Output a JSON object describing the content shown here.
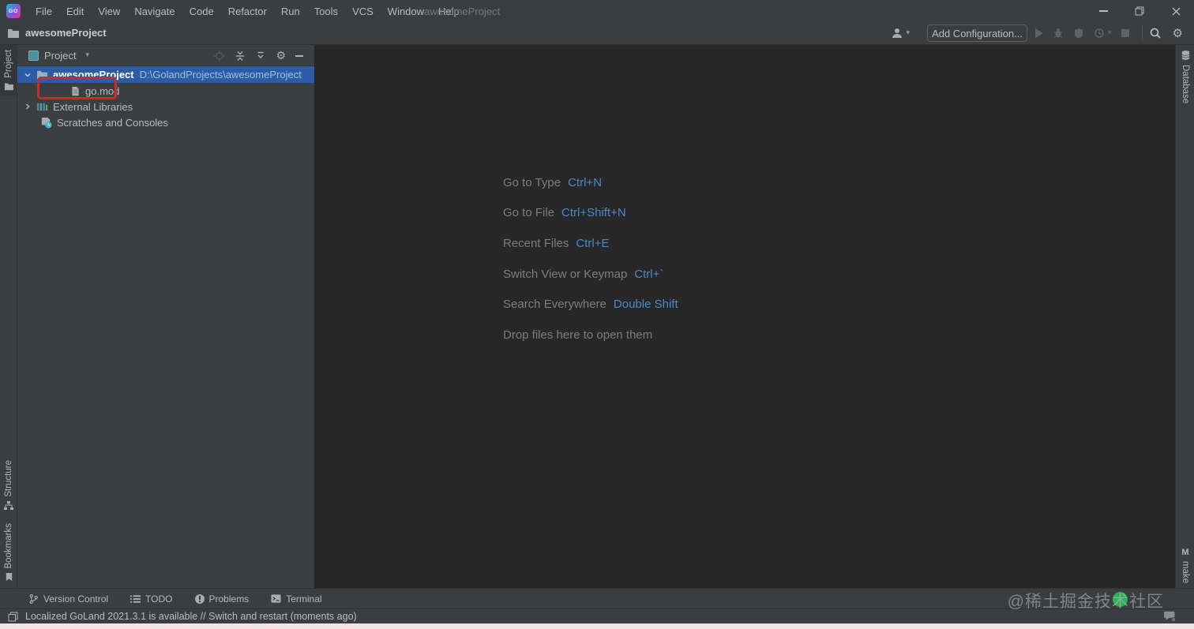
{
  "colors": {
    "panel_bg": "#3C3F41",
    "editor_bg": "#272727",
    "selection_blue": "#2D5CA6",
    "shortcut_blue": "#4D89CB",
    "annotation_red": "#CE2A26",
    "bottom_strip_pink": "#F5E4E2"
  },
  "titlebar": {
    "logo_text": "GO",
    "menu": [
      "File",
      "Edit",
      "View",
      "Navigate",
      "Code",
      "Refactor",
      "Run",
      "Tools",
      "VCS",
      "Window",
      "Help"
    ],
    "title": "awesomeProject"
  },
  "toolbar": {
    "breadcrumb": "awesomeProject",
    "add_configuration": "Add Configuration..."
  },
  "left_stripe": {
    "project": "Project",
    "structure": "Structure",
    "bookmarks": "Bookmarks"
  },
  "right_stripe": {
    "database": "Database",
    "make_letter": "M",
    "make": "make"
  },
  "project_panel": {
    "header": "Project",
    "root_name": "awesomeProject",
    "root_path": "D:\\GolandProjects\\awesomeProject",
    "gomod": "go.mod",
    "external_libraries": "External Libraries",
    "scratches": "Scratches and Consoles"
  },
  "editor": {
    "shortcuts": [
      {
        "label": "Go to Type",
        "keys": "Ctrl+N"
      },
      {
        "label": "Go to File",
        "keys": "Ctrl+Shift+N"
      },
      {
        "label": "Recent Files",
        "keys": "Ctrl+E"
      },
      {
        "label": "Switch View or Keymap",
        "keys": "Ctrl+`"
      },
      {
        "label": "Search Everywhere",
        "keys": "Double Shift"
      }
    ],
    "drop_hint": "Drop files here to open them"
  },
  "bottom_bar": {
    "items": [
      "Version Control",
      "TODO",
      "Problems",
      "Terminal"
    ]
  },
  "status_bar": {
    "message": "Localized GoLand 2021.3.1 is available // Switch and restart (moments ago)"
  },
  "watermark": "@稀土掘金技术社区"
}
